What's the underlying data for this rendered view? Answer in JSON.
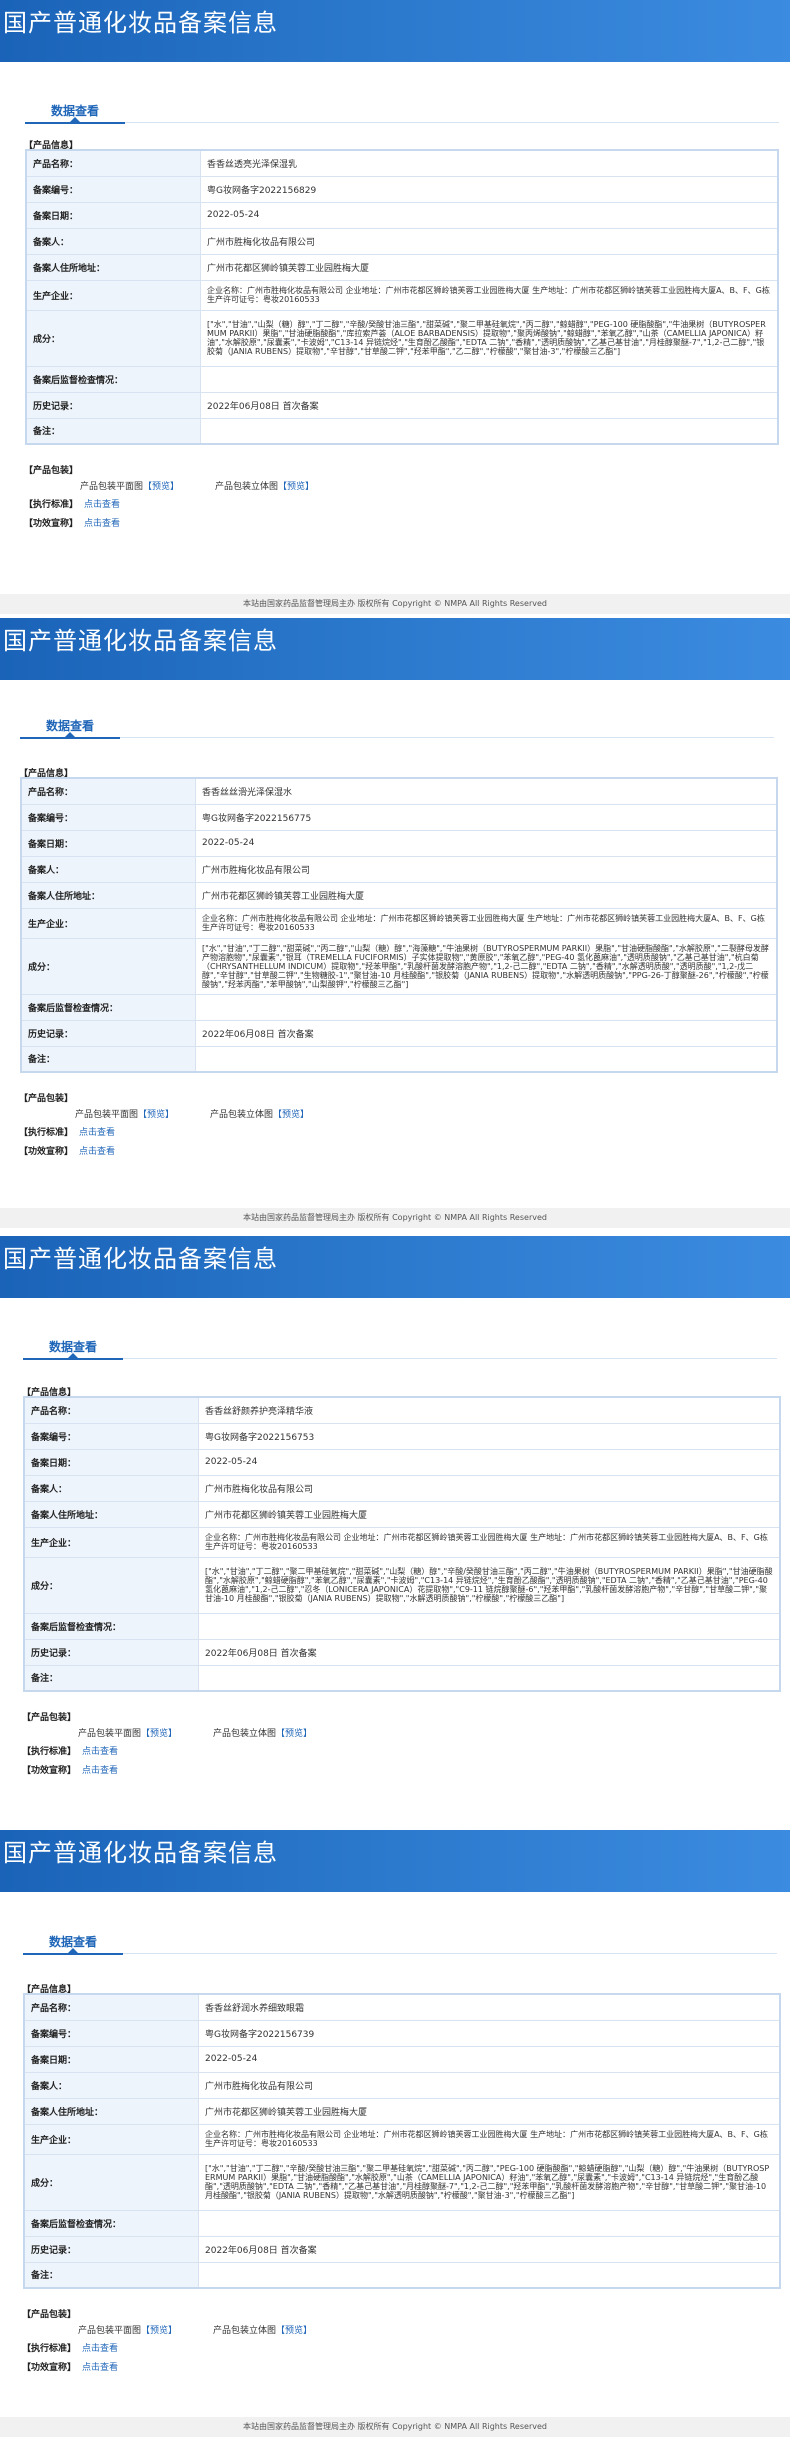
{
  "footer": "本站由国家药品监督管理局主办 版权所有 Copyright © NMPA All Rights Reserved",
  "records": [
    {
      "banner_title": "国产普通化妆品备案信息",
      "tab_label": "数据查看",
      "product_info_label": "【产品信息】",
      "fields": [
        {
          "key": "产品名称：",
          "value": "香香丝透亮光泽保湿乳"
        },
        {
          "key": "备案编号：",
          "value": "粤G妆网备字2022156829"
        },
        {
          "key": "备案日期：",
          "value": "2022-05-24"
        },
        {
          "key": "备案人：",
          "value": "广州市胜梅化妆品有限公司"
        },
        {
          "key": "备案人住所地址：",
          "value": "广州市花都区狮岭镇芙蓉工业园胜梅大厦"
        },
        {
          "key": "生产企业：",
          "value": "企业名称：广州市胜梅化妆品有限公司 企业地址：广州市花都区狮岭镇芙蓉工业园胜梅大厦 生产地址：广州市花都区狮岭镇芙蓉工业园胜梅大厦A、B、F、G栋 生产许可证号：粤妆20160533"
        },
        {
          "key": "成分：",
          "value": "[\"水\",\"甘油\",\"山梨（糖）醇\",\"丁二醇\",\"辛酸/癸酸甘油三酯\",\"甜菜碱\",\"聚二甲基硅氧烷\",\"丙二醇\",\"鲸蜡醇\",\"PEG-100 硬脂酸酯\",\"牛油果树（BUTYROSPERMUM PARKII）果脂\",\"甘油硬脂酸酯\",\"库拉索芦荟（ALOE BARBADENSIS）提取物\",\"聚丙烯酸钠\",\"鲸蜡醇\",\"苯氧乙醇\",\"山茶（CAMELLIA JAPONICA）籽油\",\"水解胶原\",\"尿囊素\",\"卡波姆\",\"C13-14 异链烷烃\",\"生育酚乙酸酯\",\"EDTA 二钠\",\"香精\",\"透明质酸钠\",\"乙基己基甘油\",\"月桂醇聚醚-7\",\"1,2-己二醇\",\"银胶菊（JANIA RUBENS）提取物\",\"辛甘醇\",\"甘草酸二钾\",\"羟苯甲酯\",\"乙二醇\",\"柠檬酸\",\"聚甘油-3\",\"柠檬酸三乙酯\"]"
        },
        {
          "key": "备案后监督检查情况：",
          "value": ""
        },
        {
          "key": "历史记录：",
          "value": "2022年06月08日 首次备案"
        },
        {
          "key": "备注：",
          "value": ""
        }
      ],
      "package_label": "【产品包装】",
      "pkg_flat": "产品包装平面图",
      "pkg_3d": "产品包装立体图",
      "preview": "【预览】",
      "exec_label": "【执行标准】",
      "exec_link": "点击查看",
      "efficacy_label": "【功效宣称】",
      "efficacy_link": "点击查看"
    },
    {
      "banner_title": "国产普通化妆品备案信息",
      "tab_label": "数据查看",
      "product_info_label": "【产品信息】",
      "fields": [
        {
          "key": "产品名称：",
          "value": "香香丝丝滑光泽保湿水"
        },
        {
          "key": "备案编号：",
          "value": "粤G妆网备字2022156775"
        },
        {
          "key": "备案日期：",
          "value": "2022-05-24"
        },
        {
          "key": "备案人：",
          "value": "广州市胜梅化妆品有限公司"
        },
        {
          "key": "备案人住所地址：",
          "value": "广州市花都区狮岭镇芙蓉工业园胜梅大厦"
        },
        {
          "key": "生产企业：",
          "value": "企业名称：广州市胜梅化妆品有限公司 企业地址：广州市花都区狮岭镇芙蓉工业园胜梅大厦 生产地址：广州市花都区狮岭镇芙蓉工业园胜梅大厦A、B、F、G栋 生产许可证号：粤妆20160533"
        },
        {
          "key": "成分：",
          "value": "[\"水\",\"甘油\",\"丁二醇\",\"甜菜碱\",\"丙二醇\",\"山梨（糖）醇\",\"海藻糖\",\"牛油果树（BUTYROSPERMUM PARKII）果脂\",\"甘油硬脂酸酯\",\"水解胶原\",\"二裂酵母发酵产物溶胞物\",\"尿囊素\",\"银耳（TREMELLA FUCIFORMIS）子实体提取物\",\"黄原胶\",\"苯氧乙醇\",\"PEG-40 氢化蓖麻油\",\"透明质酸钠\",\"乙基己基甘油\",\"杭白菊（CHRYSANTHELLUM INDICUM）提取物\",\"羟苯甲酯\",\"乳酸杆菌发酵溶胞产物\",\"1,2-己二醇\",\"EDTA 二钠\",\"香精\",\"水解透明质酸\",\"透明质酸\",\"1,2-戊二醇\",\"辛甘醇\",\"甘草酸二钾\",\"生物糖胶-1\",\"聚甘油-10 月桂酸酯\",\"银胶菊（JANIA RUBENS）提取物\",\"水解透明质酸钠\",\"PPG-26-丁醇聚醚-26\",\"柠檬酸\",\"柠檬酸钠\",\"羟苯丙酯\",\"苯甲酸钠\",\"山梨酸钾\",\"柠檬酸三乙酯\"]"
        },
        {
          "key": "备案后监督检查情况：",
          "value": ""
        },
        {
          "key": "历史记录：",
          "value": "2022年06月08日 首次备案"
        },
        {
          "key": "备注：",
          "value": ""
        }
      ],
      "package_label": "【产品包装】",
      "pkg_flat": "产品包装平面图",
      "pkg_3d": "产品包装立体图",
      "preview": "【预览】",
      "exec_label": "【执行标准】",
      "exec_link": "点击查看",
      "efficacy_label": "【功效宣称】",
      "efficacy_link": "点击查看"
    },
    {
      "banner_title": "国产普通化妆品备案信息",
      "tab_label": "数据查看",
      "product_info_label": "【产品信息】",
      "fields": [
        {
          "key": "产品名称：",
          "value": "香香丝舒颜养护亮泽精华液"
        },
        {
          "key": "备案编号：",
          "value": "粤G妆网备字2022156753"
        },
        {
          "key": "备案日期：",
          "value": "2022-05-24"
        },
        {
          "key": "备案人：",
          "value": "广州市胜梅化妆品有限公司"
        },
        {
          "key": "备案人住所地址：",
          "value": "广州市花都区狮岭镇芙蓉工业园胜梅大厦"
        },
        {
          "key": "生产企业：",
          "value": "企业名称：广州市胜梅化妆品有限公司 企业地址：广州市花都区狮岭镇芙蓉工业园胜梅大厦 生产地址：广州市花都区狮岭镇芙蓉工业园胜梅大厦A、B、F、G栋 生产许可证号：粤妆20160533"
        },
        {
          "key": "成分：",
          "value": "[\"水\",\"甘油\",\"丁二醇\",\"聚二甲基硅氧烷\",\"甜菜碱\",\"山梨（糖）醇\",\"辛酸/癸酸甘油三酯\",\"丙二醇\",\"牛油果树（BUTYROSPERMUM PARKII）果脂\",\"甘油硬脂酸酯\",\"水解胶原\",\"鲸蜡硬脂醇\",\"苯氧乙醇\",\"尿囊素\",\"卡波姆\",\"C13-14 异链烷烃\",\"生育酚乙酸酯\",\"透明质酸钠\",\"EDTA 二钠\",\"香精\",\"乙基己基甘油\",\"PEG-40 氢化蓖麻油\",\"1,2-己二醇\",\"忍冬（LONICERA JAPONICA）花提取物\",\"C9-11 链烷醇聚醚-6\",\"羟苯甲酯\",\"乳酸杆菌发酵溶胞产物\",\"辛甘醇\",\"甘草酸二钾\",\"聚甘油-10 月桂酸酯\",\"银胶菊（JANIA RUBENS）提取物\",\"水解透明质酸钠\",\"柠檬酸\",\"柠檬酸三乙酯\"]"
        },
        {
          "key": "备案后监督检查情况：",
          "value": ""
        },
        {
          "key": "历史记录：",
          "value": "2022年06月08日 首次备案"
        },
        {
          "key": "备注：",
          "value": ""
        }
      ],
      "package_label": "【产品包装】",
      "pkg_flat": "产品包装平面图",
      "pkg_3d": "产品包装立体图",
      "preview": "【预览】",
      "exec_label": "【执行标准】",
      "exec_link": "点击查看",
      "efficacy_label": "【功效宣称】",
      "efficacy_link": "点击查看"
    },
    {
      "banner_title": "国产普通化妆品备案信息",
      "tab_label": "数据查看",
      "product_info_label": "【产品信息】",
      "fields": [
        {
          "key": "产品名称：",
          "value": "香香丝舒润水养细致眼霜"
        },
        {
          "key": "备案编号：",
          "value": "粤G妆网备字2022156739"
        },
        {
          "key": "备案日期：",
          "value": "2022-05-24"
        },
        {
          "key": "备案人：",
          "value": "广州市胜梅化妆品有限公司"
        },
        {
          "key": "备案人住所地址：",
          "value": "广州市花都区狮岭镇芙蓉工业园胜梅大厦"
        },
        {
          "key": "生产企业：",
          "value": "企业名称：广州市胜梅化妆品有限公司 企业地址：广州市花都区狮岭镇芙蓉工业园胜梅大厦 生产地址：广州市花都区狮岭镇芙蓉工业园胜梅大厦A、B、F、G栋 生产许可证号：粤妆20160533"
        },
        {
          "key": "成分：",
          "value": "[\"水\",\"甘油\",\"丁二醇\",\"辛酸/癸酸甘油三酯\",\"聚二甲基硅氧烷\",\"甜菜碱\",\"丙二醇\",\"PEG-100 硬脂酸酯\",\"鲸蜡硬脂醇\",\"山梨（糖）醇\",\"牛油果树（BUTYROSPERMUM PARKII）果脂\",\"甘油硬脂酸酯\",\"水解胶原\",\"山茶（CAMELLIA JAPONICA）籽油\",\"苯氧乙醇\",\"尿囊素\",\"卡波姆\",\"C13-14 异链烷烃\",\"生育酚乙酸酯\",\"透明质酸钠\",\"EDTA 二钠\",\"香精\",\"乙基己基甘油\",\"月桂醇聚醚-7\",\"1,2-己二醇\",\"羟苯甲酯\",\"乳酸杆菌发酵溶胞产物\",\"辛甘醇\",\"甘草酸二钾\",\"聚甘油-10 月桂酸酯\",\"银胶菊（JANIA RUBENS）提取物\",\"水解透明质酸钠\",\"柠檬酸\",\"聚甘油-3\",\"柠檬酸三乙酯\"]"
        },
        {
          "key": "备案后监督检查情况：",
          "value": ""
        },
        {
          "key": "历史记录：",
          "value": "2022年06月08日 首次备案"
        },
        {
          "key": "备注：",
          "value": ""
        }
      ],
      "package_label": "【产品包装】",
      "pkg_flat": "产品包装平面图",
      "pkg_3d": "产品包装立体图",
      "preview": "【预览】",
      "exec_label": "【执行标准】",
      "exec_link": "点击查看",
      "efficacy_label": "【功效宣称】",
      "efficacy_link": "点击查看"
    }
  ]
}
